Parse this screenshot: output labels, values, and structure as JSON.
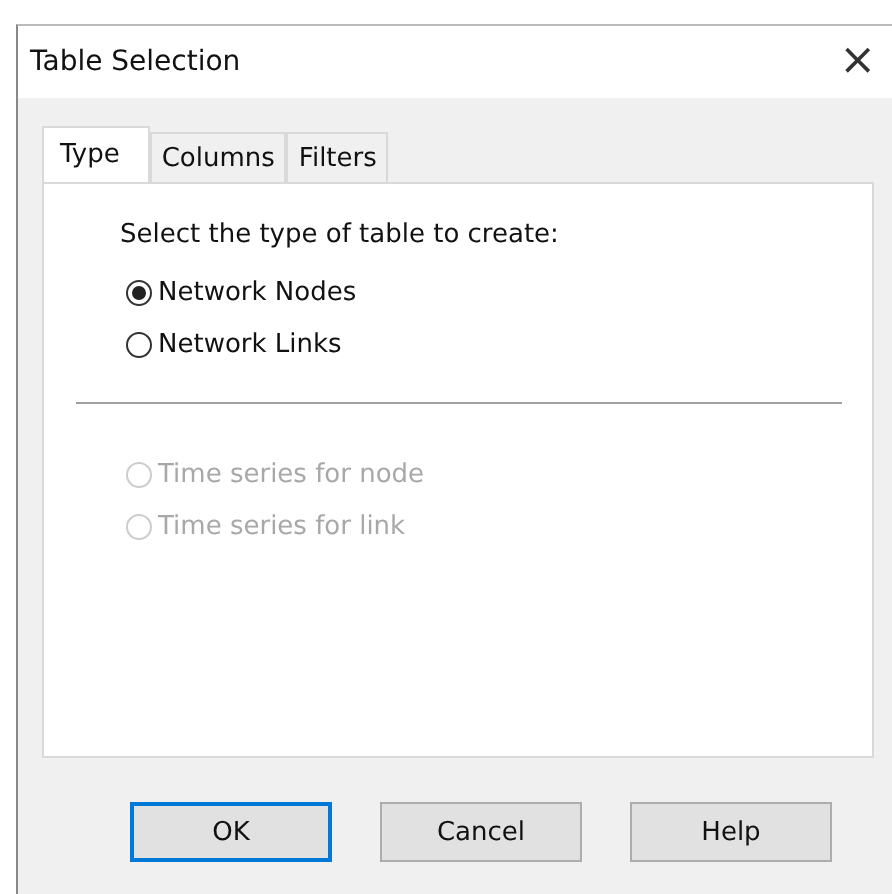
{
  "window": {
    "title": "Table Selection",
    "close": "×"
  },
  "tabs": [
    {
      "label": "Type",
      "selected": true
    },
    {
      "label": "Columns",
      "selected": false
    },
    {
      "label": "Filters",
      "selected": false
    }
  ],
  "prompt": "Select the type of table to create:",
  "table_types": [
    {
      "label": "Network Nodes",
      "selected": true,
      "disabled": false
    },
    {
      "label": "Network Links",
      "selected": false,
      "disabled": false
    }
  ],
  "time_series": [
    {
      "label": "Time series for node",
      "selected": false,
      "disabled": true
    },
    {
      "label": "Time series for link",
      "selected": false,
      "disabled": true
    }
  ],
  "buttons": [
    {
      "label": "OK",
      "default": true
    },
    {
      "label": "Cancel",
      "default": false
    },
    {
      "label": "Help",
      "default": false
    }
  ]
}
